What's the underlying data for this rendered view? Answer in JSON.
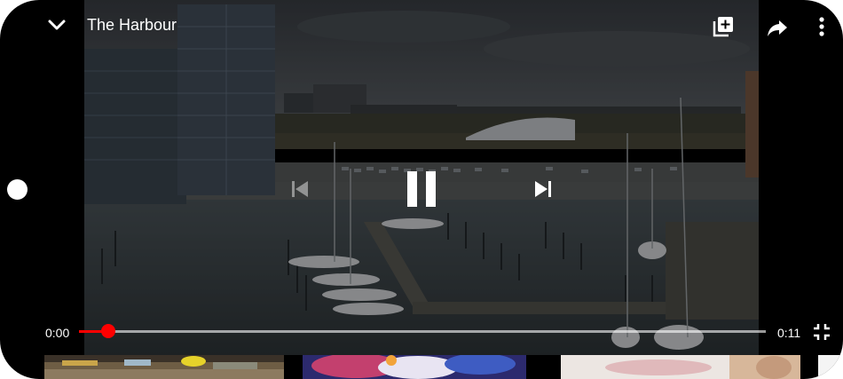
{
  "player": {
    "title": "The Harbour",
    "current_time": "0:00",
    "duration": "0:11",
    "progress": 0.0,
    "is_playing": true,
    "icons": {
      "collapse": "chevron-down-icon",
      "add_to_playlist": "playlist-add-icon",
      "share": "share-icon",
      "more": "more-vert-icon",
      "previous": "skip-previous-icon",
      "play_pause": "pause-icon",
      "next": "skip-next-icon",
      "fullscreen": "fullscreen-exit-icon"
    },
    "colors": {
      "progress": "#ff0000",
      "track": "#ffffff"
    }
  },
  "up_next": {
    "items": [
      {
        "name": "restaurant-interior-thumbnail"
      },
      {
        "name": "paint-art-thumbnail"
      },
      {
        "name": "painting-hands-thumbnail"
      }
    ]
  }
}
